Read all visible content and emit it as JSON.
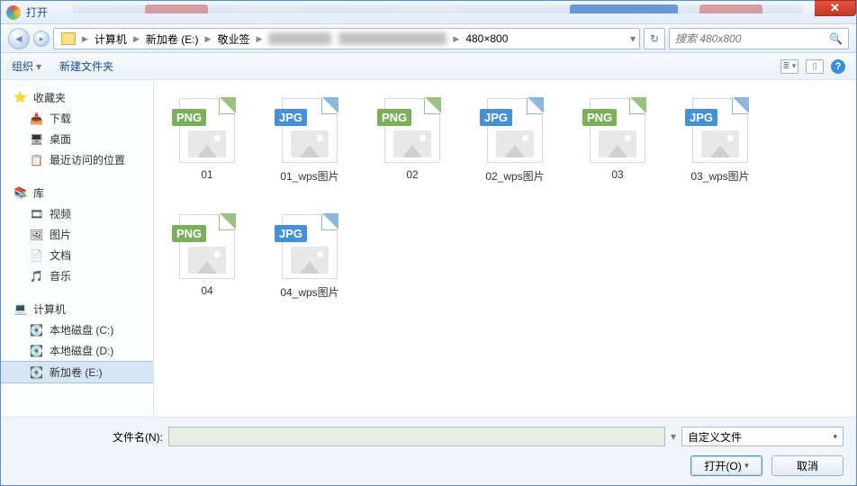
{
  "window": {
    "title": "打开"
  },
  "breadcrumb": {
    "items": [
      "计算机",
      "新加卷 (E:)",
      "敬业签",
      "？？？",
      "480×800"
    ]
  },
  "search": {
    "placeholder": "搜索 480x800"
  },
  "toolbar": {
    "organize": "组织",
    "new_folder": "新建文件夹"
  },
  "sidebar": {
    "favorites": {
      "label": "收藏夹",
      "items": [
        "下载",
        "桌面",
        "最近访问的位置"
      ]
    },
    "libraries": {
      "label": "库",
      "items": [
        "视频",
        "图片",
        "文档",
        "音乐"
      ]
    },
    "computer": {
      "label": "计算机",
      "items": [
        "本地磁盘 (C:)",
        "本地磁盘 (D:)",
        "新加卷 (E:)"
      ]
    }
  },
  "files": [
    {
      "name": "01",
      "type": "PNG"
    },
    {
      "name": "01_wps图片",
      "type": "JPG"
    },
    {
      "name": "02",
      "type": "PNG"
    },
    {
      "name": "02_wps图片",
      "type": "JPG"
    },
    {
      "name": "03",
      "type": "PNG"
    },
    {
      "name": "03_wps图片",
      "type": "JPG"
    },
    {
      "name": "04",
      "type": "PNG"
    },
    {
      "name": "04_wps图片",
      "type": "JPG"
    }
  ],
  "bottom": {
    "filename_label": "文件名(N):",
    "filename_value": "",
    "filetype": "自定义文件",
    "open": "打开(O)",
    "cancel": "取消"
  }
}
